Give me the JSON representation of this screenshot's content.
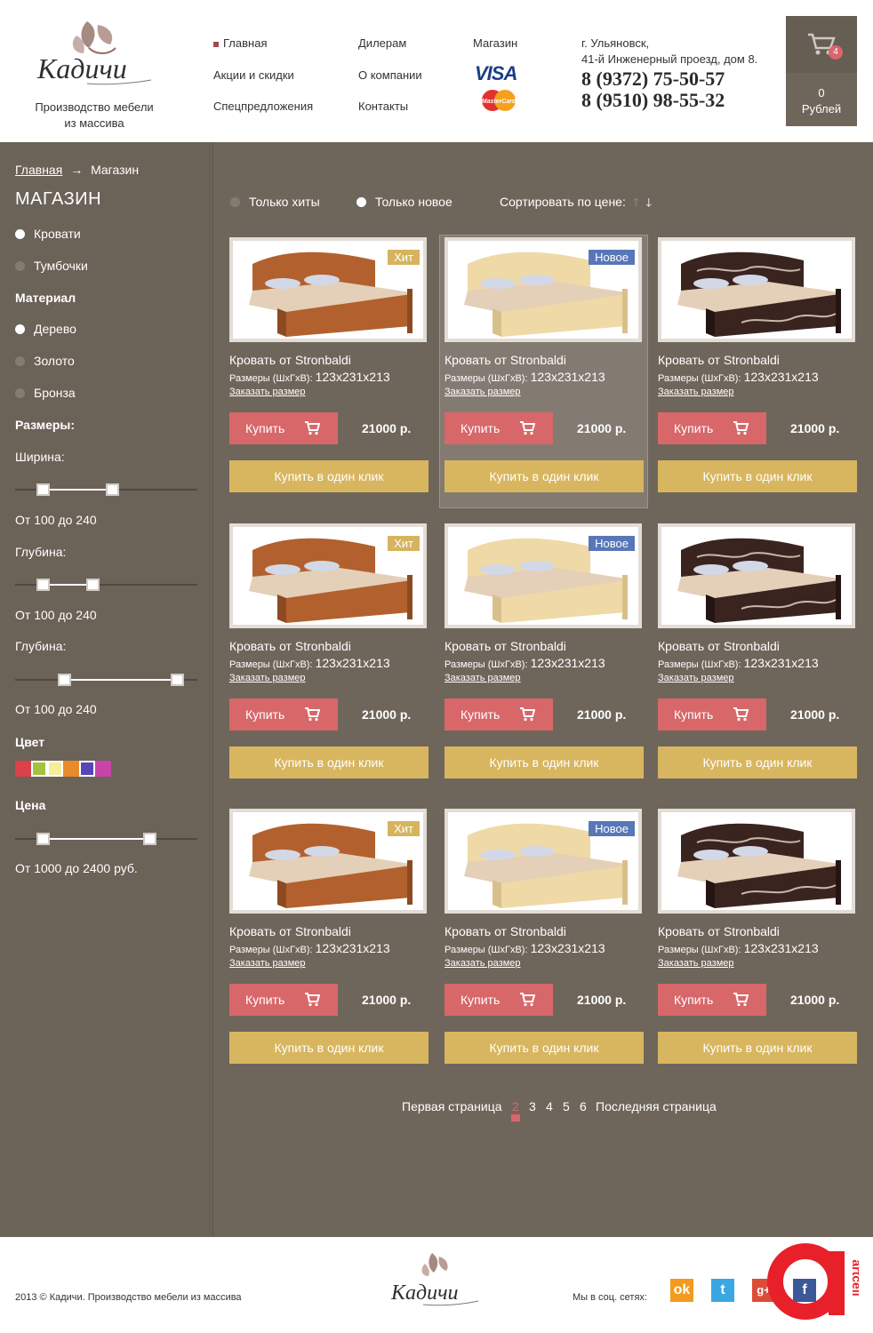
{
  "brand": {
    "name": "Кадичи",
    "tagline_1": "Производство мебели",
    "tagline_2": "из массива"
  },
  "nav": {
    "col1": [
      "Главная",
      "Акции и скидки",
      "Спецпредложения"
    ],
    "col2": [
      "Дилерам",
      "О компании",
      "Контакты"
    ],
    "shop": "Магазин",
    "visa": "VISA",
    "mastercard": "MasterCard"
  },
  "contact": {
    "city": "г. Ульяновск,",
    "street": "41-й Инженерный проезд, дом 8.",
    "phone1": "8 (9372) 75-50-57",
    "phone2": "8 (9510) 98-55-32"
  },
  "cart": {
    "count": "4",
    "sum": "0",
    "currency": "Рублей"
  },
  "breadcrumb": {
    "home": "Главная",
    "arrow": "→",
    "current": "Магазин"
  },
  "sidebar": {
    "title": "МАГАЗИН",
    "categories": [
      "Кровати",
      "Тумбочки"
    ],
    "material_title": "Материал",
    "materials": [
      "Дерево",
      "Золото",
      "Бронза"
    ],
    "sizes_title": "Размеры:",
    "width_label": "Ширина:",
    "width_range": "От 100 до 240",
    "depth_label": "Глубина:",
    "depth_range": "От 100 до 240",
    "depth2_label": "Глубина:",
    "depth2_range": "От 100 до 240",
    "color_title": "Цвет",
    "colors": [
      "#d9414b",
      "#a3c23e",
      "#f5ee9a",
      "#e88b2a",
      "#5845b8",
      "#c844a6"
    ],
    "price_title": "Цена",
    "price_range": "От 1000 до 2400 руб."
  },
  "filters": {
    "only_hits": "Только хиты",
    "only_new": "Только новое",
    "sort_label": "Сортировать по цене:",
    "up_icon": "arrow-up-icon",
    "down_icon": "arrow-down-icon"
  },
  "products": [
    {
      "tag": "Хит",
      "name": "Кровать от Stronbaldi",
      "size_label": "Размеры (ШхГхВ):",
      "size": "123x231x213",
      "order": "Заказать размер",
      "buy": "Купить",
      "price": "21000 р.",
      "one_click": "Купить в один клик"
    },
    {
      "tag": "Новое",
      "name": "Кровать от Stronbaldi",
      "size_label": "Размеры (ШхГхВ):",
      "size": "123x231x213",
      "order": "Заказать размер",
      "buy": "Купить",
      "price": "21000 р.",
      "one_click": "Купить в один клик"
    },
    {
      "tag": "",
      "name": "Кровать от Stronbaldi",
      "size_label": "Размеры (ШхГхВ):",
      "size": "123x231x213",
      "order": "Заказать размер",
      "buy": "Купить",
      "price": "21000 р.",
      "one_click": "Купить в один клик"
    },
    {
      "tag": "Хит",
      "name": "Кровать от Stronbaldi",
      "size_label": "Размеры (ШхГхВ):",
      "size": "123x231x213",
      "order": "Заказать размер",
      "buy": "Купить",
      "price": "21000 р.",
      "one_click": "Купить в один клик"
    },
    {
      "tag": "Новое",
      "name": "Кровать от Stronbaldi",
      "size_label": "Размеры (ШхГхВ):",
      "size": "123x231x213",
      "order": "Заказать размер",
      "buy": "Купить",
      "price": "21000 р.",
      "one_click": "Купить в один клик"
    },
    {
      "tag": "",
      "name": "Кровать от Stronbaldi",
      "size_label": "Размеры (ШхГхВ):",
      "size": "123x231x213",
      "order": "Заказать размер",
      "buy": "Купить",
      "price": "21000 р.",
      "one_click": "Купить в один клик"
    },
    {
      "tag": "Хит",
      "name": "Кровать от Stronbaldi",
      "size_label": "Размеры (ШхГхВ):",
      "size": "123x231x213",
      "order": "Заказать размер",
      "buy": "Купить",
      "price": "21000 р.",
      "one_click": "Купить в один клик"
    },
    {
      "tag": "Новое",
      "name": "Кровать от Stronbaldi",
      "size_label": "Размеры (ШхГхВ):",
      "size": "123x231x213",
      "order": "Заказать размер",
      "buy": "Купить",
      "price": "21000 р.",
      "one_click": "Купить в один клик"
    },
    {
      "tag": "",
      "name": "Кровать от Stronbaldi",
      "size_label": "Размеры (ШхГхВ):",
      "size": "123x231x213",
      "order": "Заказать размер",
      "buy": "Купить",
      "price": "21000 р.",
      "one_click": "Купить в один клик"
    }
  ],
  "pagination": {
    "first": "Первая страница",
    "pages": [
      "2",
      "3",
      "4",
      "5",
      "6"
    ],
    "current": "2",
    "last": "Последняя страница"
  },
  "footer": {
    "copyright": "2013 © Кадичи. Производство мебели из массива",
    "social_label": "Мы в соц. сетях:",
    "watermark": "artcell"
  }
}
